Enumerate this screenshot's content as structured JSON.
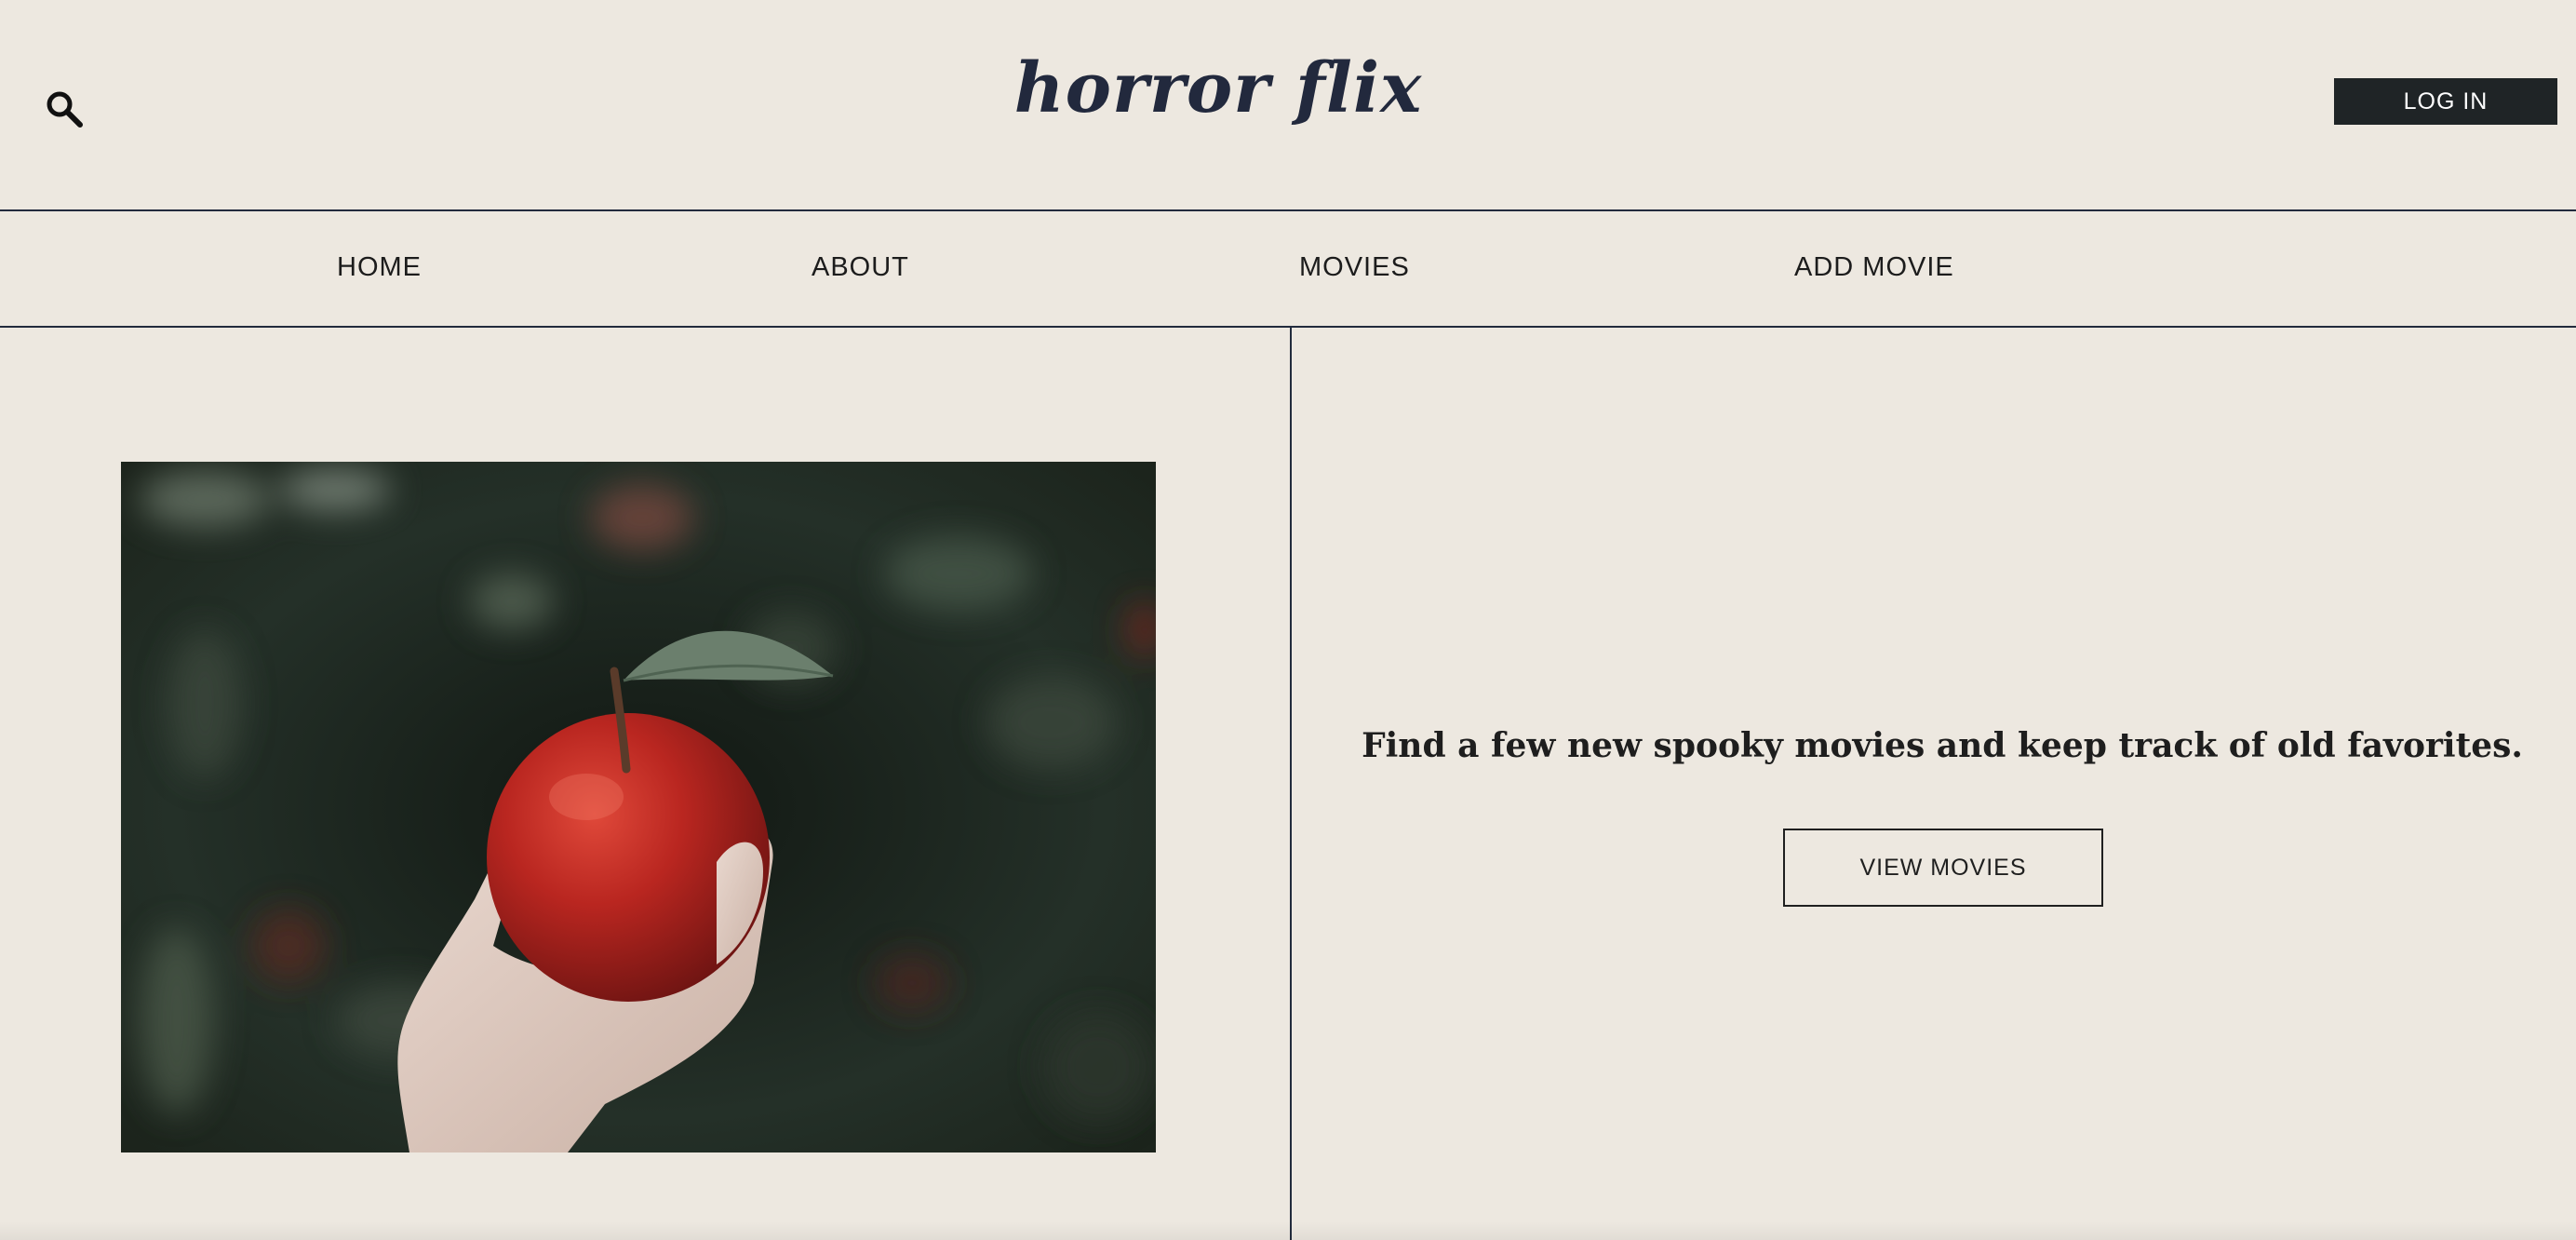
{
  "header": {
    "logo": "horror flix",
    "search_icon": "search-icon",
    "login_label": "LOG IN"
  },
  "nav": {
    "items": [
      {
        "label": "HOME"
      },
      {
        "label": "ABOUT"
      },
      {
        "label": "MOVIES"
      },
      {
        "label": "ADD MOVIE"
      }
    ]
  },
  "hero": {
    "image_description_icon": "apple-in-hand-photo",
    "tagline": "Find a few new spooky movies and keep track of old favorites.",
    "cta_label": "VIEW MOVIES"
  },
  "colors": {
    "background": "#ede8e0",
    "text_dark": "#22293d",
    "button_dark": "#1f2426",
    "apple_red": "#b3211d"
  }
}
